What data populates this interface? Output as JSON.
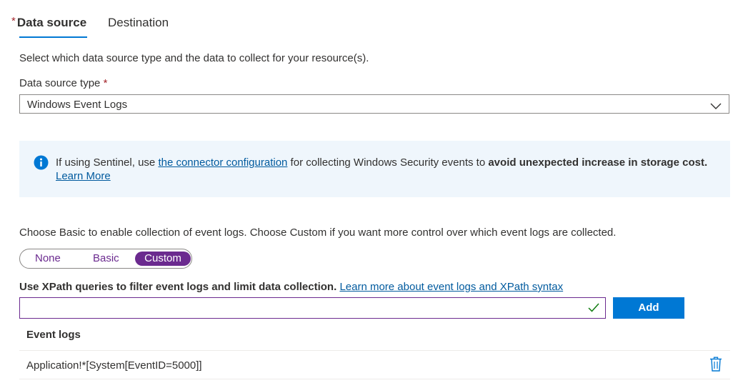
{
  "tabs": {
    "required_mark": "*",
    "data_source": "Data source",
    "destination": "Destination"
  },
  "intro_text": "Select which data source type and the data to collect for your resource(s).",
  "data_source_type": {
    "label": "Data source type",
    "required_mark": "*",
    "value": "Windows Event Logs"
  },
  "info_bar": {
    "text_before_link": "If using Sentinel, use ",
    "link_text": "the connector configuration",
    "text_after_link": " for collecting Windows Security events to ",
    "bold_text": "avoid unexpected increase in storage cost.",
    "learn_more": "Learn More"
  },
  "choose_text": "Choose Basic to enable collection of event logs. Choose Custom if you want more control over which event logs are collected.",
  "mode_toggle": {
    "options": [
      "None",
      "Basic",
      "Custom"
    ],
    "selected": "Custom"
  },
  "xpath": {
    "label": "Use XPath queries to filter event logs and limit data collection.",
    "link_text": "Learn more about event logs and XPath syntax",
    "input_value": "",
    "add_button": "Add"
  },
  "event_logs": {
    "header": "Event logs",
    "rows": [
      "Application!*[System[EventID=5000]]"
    ]
  },
  "colors": {
    "accent_blue": "#0078d4",
    "purple": "#6b2a8f",
    "required_red": "#a4262c",
    "info_bg": "#eff6fc",
    "check_green": "#107c10"
  },
  "icons": {
    "chevron": "chevron-down-icon",
    "info": "info-icon",
    "check": "checkmark-icon",
    "delete": "trash-icon"
  }
}
